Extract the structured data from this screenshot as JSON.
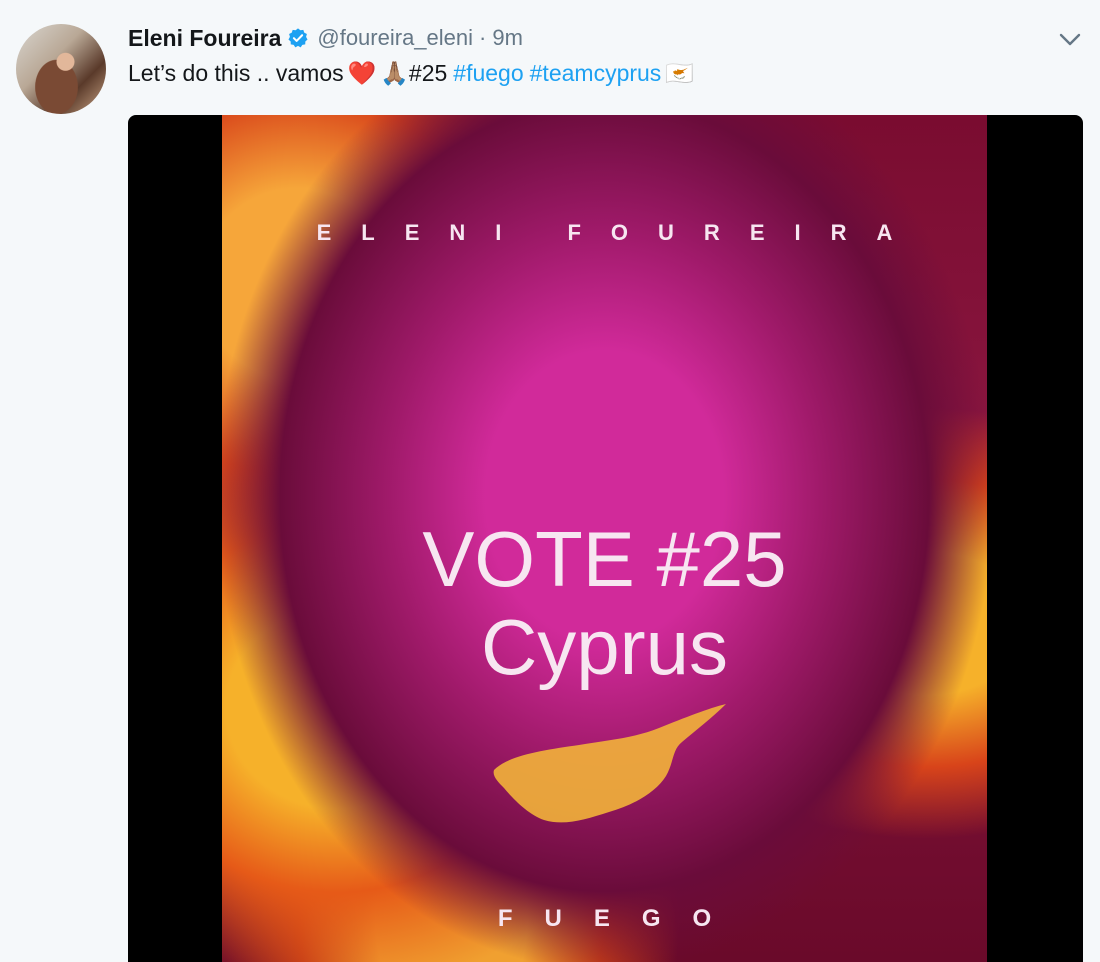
{
  "tweet": {
    "author_name": "Eleni Foureira",
    "author_handle": "@foureira_eleni",
    "separator": "·",
    "time_ago": "9m",
    "text_prefix": "Let’s do this .. vamos",
    "emoji_heart": "❤️",
    "emoji_pray": "🙏🏽",
    "text_number": "#25",
    "hashtags": [
      "#fuego",
      "#teamcyprus"
    ],
    "emoji_flag": "🇨🇾"
  },
  "media": {
    "artist_text": "ELENI FOUREIRA",
    "vote_text": "VOTE #25",
    "country_text": "Cyprus",
    "song_text": "FUEGO"
  },
  "colors": {
    "hashtag": "#1da1f2",
    "verified_badge": "#1da1f2",
    "muted_text": "#657786",
    "background": "#f5f8fa"
  },
  "icons": [
    "verified-badge-icon",
    "chevron-down-icon",
    "cyprus-map-icon"
  ]
}
